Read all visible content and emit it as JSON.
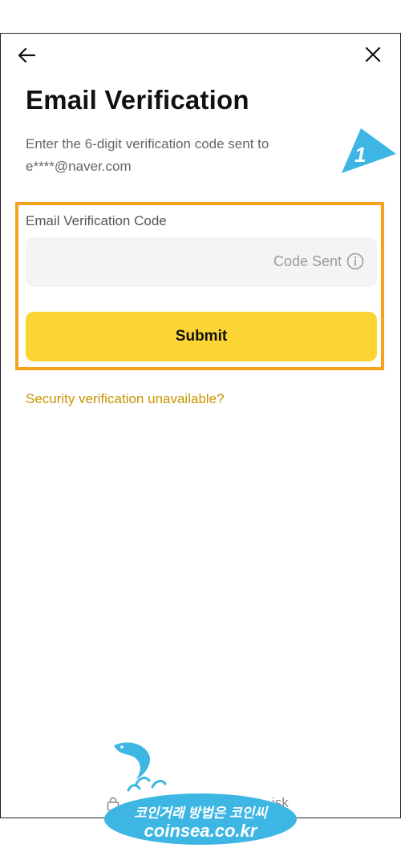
{
  "header": {
    "back_icon": "arrow-left-icon",
    "close_icon": "close-icon"
  },
  "page": {
    "title": "Email Verification",
    "subtitle": "Enter the 6-digit verification code sent to e****@naver.com"
  },
  "form": {
    "field_label": "Email Verification Code",
    "input_value": "",
    "code_sent_label": "Code Sent",
    "info_icon": "info-icon",
    "submit_label": "Submit"
  },
  "links": {
    "security_unavailable": "Security verification unavailable?"
  },
  "annotation": {
    "step_number": "1",
    "highlight_color": "#f7a21c",
    "marker_color": "#3eb6e4"
  },
  "footer": {
    "partial_text": "isk"
  },
  "watermark": {
    "line1": "코인거래 방법은 코인씨",
    "line2": "coinsea.co.kr"
  },
  "colors": {
    "primary_button": "#fcd535",
    "link": "#c99400",
    "input_bg": "#f4f4f4"
  }
}
